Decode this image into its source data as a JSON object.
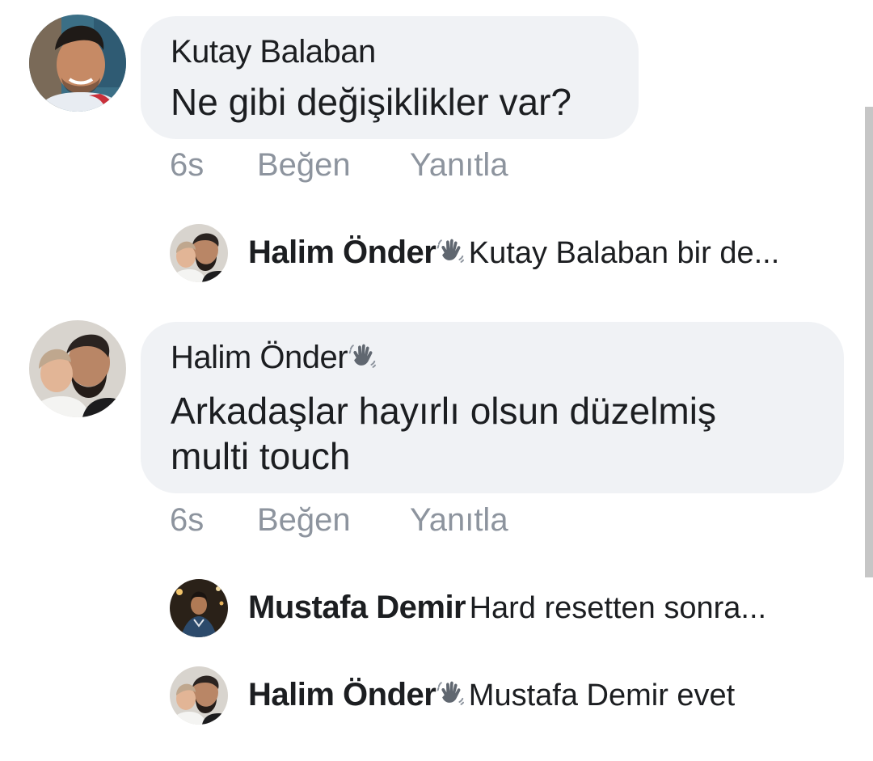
{
  "comments": [
    {
      "author": "Kutay Balaban",
      "text": "Ne gibi değişiklikler var?",
      "time": "6s",
      "like_label": "Beğen",
      "reply_label": "Yanıtla",
      "avatar_icon": "person-avatar"
    },
    {
      "author": "Halim Önder",
      "author_badge_icon": "wave-hand-icon",
      "text_line1": "Arkadaşlar hayırlı olsun düzelmiş",
      "text_line2": "multi touch",
      "time": "6s",
      "like_label": "Beğen",
      "reply_label": "Yanıtla",
      "avatar_icon": "person-avatar"
    }
  ],
  "reply_previews": [
    {
      "author": "Halim Önder",
      "badge_icon": "wave-hand-icon",
      "snippet": "Kutay Balaban bir de..."
    },
    {
      "author": "Mustafa Demir",
      "snippet": "Hard resetten sonra..."
    },
    {
      "author": "Halim Önder",
      "badge_icon": "wave-hand-icon",
      "snippet": "Mustafa Demir evet"
    }
  ],
  "colors": {
    "bubble": "#f0f2f5",
    "meta_text": "#8d949e",
    "primary_text": "#1c1e21"
  }
}
